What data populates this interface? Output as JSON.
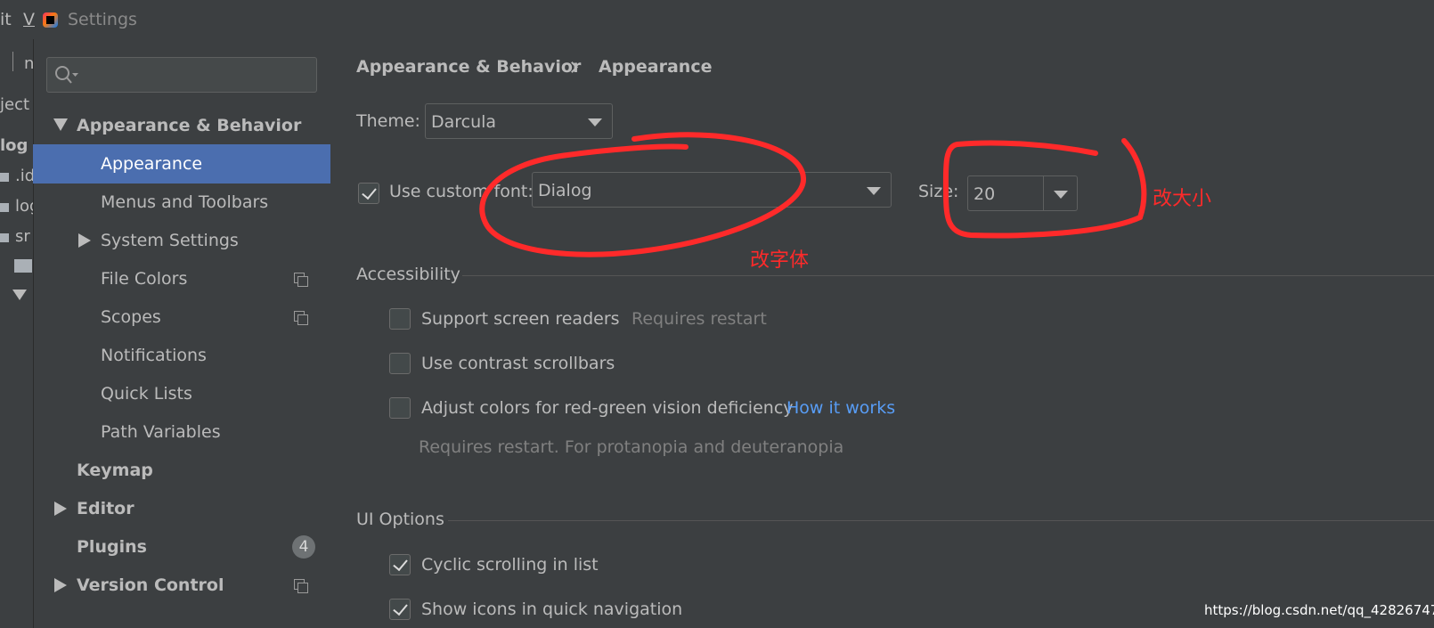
{
  "window": {
    "title": "Settings",
    "menu_fragments": [
      "it",
      "V"
    ]
  },
  "background_ide": {
    "fragments": [
      "n",
      "ject",
      "log",
      ".id",
      "log",
      "sr"
    ]
  },
  "search": {
    "placeholder": ""
  },
  "sidebar": {
    "items": [
      {
        "label": "Appearance & Behavior",
        "expanded": true,
        "bold": true
      },
      {
        "label": "Appearance",
        "selected": true
      },
      {
        "label": "Menus and Toolbars"
      },
      {
        "label": "System Settings",
        "collapsed": true
      },
      {
        "label": "File Colors",
        "icon": "copy-icon"
      },
      {
        "label": "Scopes",
        "icon": "copy-icon"
      },
      {
        "label": "Notifications"
      },
      {
        "label": "Quick Lists"
      },
      {
        "label": "Path Variables"
      },
      {
        "label": "Keymap",
        "bold": true
      },
      {
        "label": "Editor",
        "bold": true,
        "collapsed": true
      },
      {
        "label": "Plugins",
        "bold": true,
        "badge": "4"
      },
      {
        "label": "Version Control",
        "bold": true,
        "collapsed": true,
        "icon": "copy-icon"
      }
    ]
  },
  "breadcrumb": {
    "parent": "Appearance & Behavior",
    "current": "Appearance"
  },
  "theme": {
    "label": "Theme:",
    "value": "Darcula"
  },
  "custom_font": {
    "label": "Use custom font:",
    "checked": true,
    "value": "Dialog",
    "size_label": "Size:",
    "size_value": "20"
  },
  "accessibility": {
    "header": "Accessibility",
    "screen_readers": {
      "label": "Support screen readers",
      "note": "Requires restart",
      "checked": false
    },
    "contrast_scrollbars": {
      "label": "Use contrast scrollbars",
      "checked": false
    },
    "color_deficiency": {
      "label": "Adjust colors for red-green vision deficiency",
      "link": "How it works",
      "note": "Requires restart. For protanopia and deuteranopia",
      "checked": false
    }
  },
  "ui_options": {
    "header": "UI Options",
    "cyclic_scrolling": {
      "label": "Cyclic scrolling in list",
      "checked": true
    },
    "quick_nav_icons": {
      "label": "Show icons in quick navigation",
      "checked": true
    }
  },
  "annotations": {
    "font_note": "改字体",
    "size_note": "改大小",
    "color": "#ff2a2a"
  },
  "watermark": "https://blog.csdn.net/qq_42826747",
  "colors": {
    "background": "#3c3f41",
    "selection": "#4b6eaf",
    "link": "#589df6",
    "annotation": "#ff2a2a"
  }
}
